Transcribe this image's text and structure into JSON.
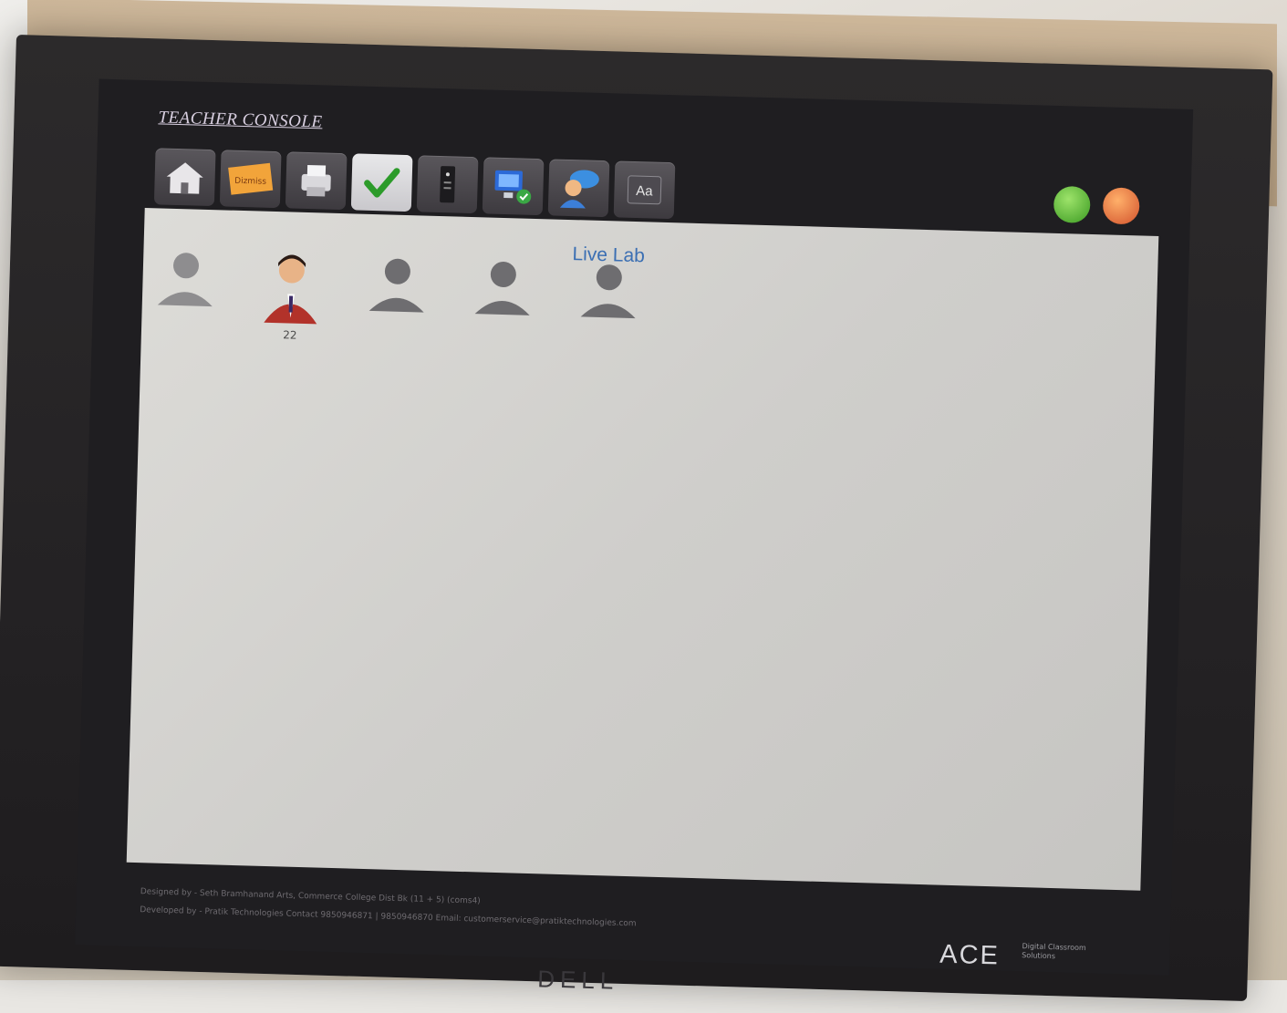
{
  "console": {
    "title": "TEACHER CONSOLE",
    "toolbar": [
      {
        "name": "home",
        "icon": "home-icon"
      },
      {
        "name": "notes",
        "icon": "sticky-note-icon",
        "badge_text": "Dizmiss"
      },
      {
        "name": "print",
        "icon": "printer-icon"
      },
      {
        "name": "check",
        "icon": "checkmark-icon"
      },
      {
        "name": "tower",
        "icon": "pc-tower-icon"
      },
      {
        "name": "network",
        "icon": "network-computer-icon"
      },
      {
        "name": "user-chat",
        "icon": "user-chat-icon"
      },
      {
        "name": "font",
        "icon": "font-icon",
        "label": "Aa"
      }
    ],
    "window_controls": [
      "minimize-green",
      "close-orange"
    ]
  },
  "live_lab": {
    "title": "Live Lab",
    "seats": [
      {
        "status": "empty",
        "label": ""
      },
      {
        "status": "active",
        "label": "22"
      },
      {
        "status": "empty",
        "label": ""
      },
      {
        "status": "empty",
        "label": ""
      },
      {
        "status": "empty",
        "label": ""
      }
    ]
  },
  "footer": {
    "line1": "Designed by - Seth Bramhanand Arts, Commerce College Dist Bk (11 + 5) (coms4)",
    "line2": "Developed by - Pratik Technologies Contact 9850946871 | 9850946870 Email: customerservice@pratiktechnologies.com"
  },
  "branding": {
    "ace": "ACE",
    "ace_sub": "Digital Classroom Solutions",
    "monitor": "DELL"
  },
  "colors": {
    "accent_blue": "#3b6fb3",
    "green_button": "#4fae2e",
    "orange_button": "#e0652f"
  }
}
